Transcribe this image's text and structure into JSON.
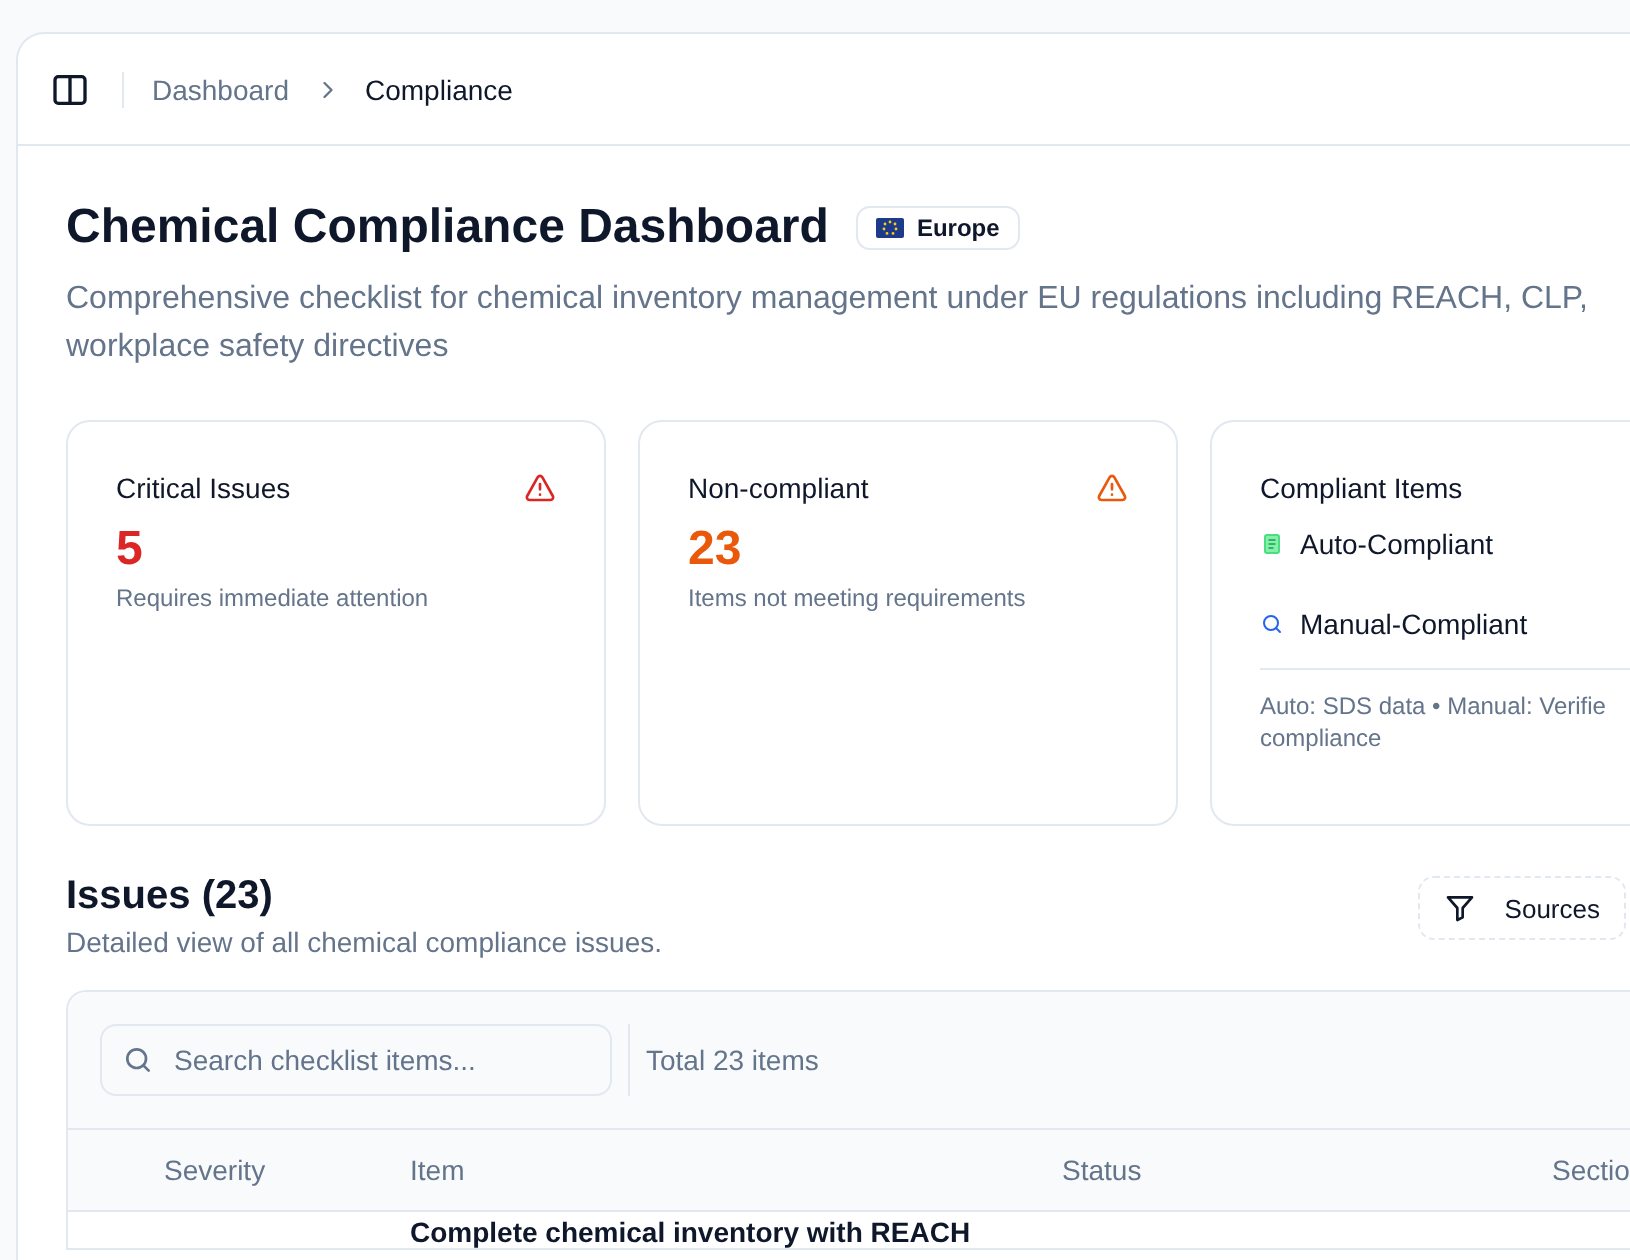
{
  "breadcrumb": {
    "items": [
      {
        "label": "Dashboard",
        "current": false
      },
      {
        "label": "Compliance",
        "current": true
      }
    ]
  },
  "page": {
    "title": "Chemical Compliance Dashboard",
    "region_badge": "Europe",
    "subtitle_lines": [
      "Comprehensive checklist for chemical inventory management under EU regulations including REACH, CLP,",
      "workplace safety directives"
    ]
  },
  "stats": [
    {
      "kind": "count",
      "title": "Critical Issues",
      "value": "5",
      "caption": "Requires immediate attention",
      "color": "#dc2626"
    },
    {
      "kind": "count",
      "title": "Non-compliant",
      "value": "23",
      "caption": "Items not meeting requirements",
      "color": "#ea580c"
    },
    {
      "kind": "legend",
      "title": "Compliant Items",
      "entries": [
        {
          "kind": "document",
          "label": "Auto-Compliant"
        },
        {
          "kind": "search",
          "label": "Manual-Compliant"
        }
      ],
      "note_lines": [
        "Auto: SDS data • Manual: Verifie",
        "compliance"
      ]
    }
  ],
  "issues": {
    "title": "Issues (23)",
    "description": "Detailed view of all chemical compliance issues.",
    "filter_button": "Sources",
    "search": {
      "placeholder": "Search checklist items..."
    },
    "total": "Total 23 items",
    "columns": [
      "Severity",
      "Item",
      "Status",
      "Sectio"
    ],
    "rows": [
      {
        "item": "Complete chemical inventory with REACH"
      }
    ]
  }
}
